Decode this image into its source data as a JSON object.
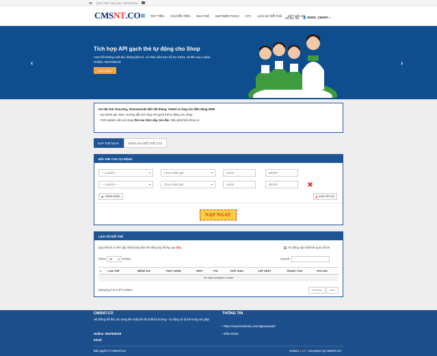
{
  "topbar": {
    "contact": "(0947 838 128) Zalo: 0947838128"
  },
  "brand": {
    "logo_part1": "CMS",
    "logo_part2": "NT",
    "logo_part3": ".CO"
  },
  "nav": {
    "items": [
      "RÚT TIỀN",
      "CHUYỂN TIỀN",
      "MUA THẺ",
      "NẠP ĐIỆN THOẠI",
      "CTV",
      "LỊCH SỬ ĐỔI THẺ",
      "KẾT NỐI API"
    ],
    "balance": "Số Dư: 0đ",
    "user": "DEMO_CMSNT"
  },
  "hero": {
    "title": "Tích hợp API gạch thẻ tự động cho Shop",
    "description": "Cam kết không nuốt thẻ, không bảo trì, có nhân viên trực hỗ trợ 24/24, rút tiền sau 1 phút. Hotline: 0947838128",
    "button": "XEM NGAY",
    "prev": "‹",
    "next": "›"
  },
  "notice": {
    "line1": "Ưu tiên thẻ Vina,Zing, Vietnammobi đến hết thẻng. Viettel và Zing cân điền đúng SERI",
    "line2": "- Sai mệnh giá -50%. Hướng dẫn tích hợp API gạch thẻ tự động cho Shop.",
    "line3_prefix": "- TSR nghiêm cấm sử dụng ",
    "line3_bold": "thẻ cào trộm cắp, lừa đảo",
    "line3_suffix": ". Nếu phát hiện khóa vv"
  },
  "tabs": {
    "active": "NẠP THẺ NGAY",
    "inactive": "BẢNG GIÁ ĐỔI THẺ CÀO"
  },
  "exchange": {
    "header": "ĐỔI THẺ CÀO TỰ ĐỘNG",
    "type_placeholder": "-- Loại thẻ --",
    "amount_placeholder": "Chọn mệnh giá",
    "serial_placeholder": "Serial",
    "code_placeholder": "Mã thẻ",
    "add_button": "THÊM NGÀY",
    "clear_button": "XOÁ TẤT CẢ",
    "submit": "NẠP NGAY"
  },
  "history": {
    "header": "LỊCH SỬ ĐỔI THẺ",
    "hint_prefix": "Quý khách có thể cập nhật trạng thái thẻ bằng tay thông qua ",
    "hint_link": "đây",
    "auto_update": "Tự động cập nhật kết quả mỗi 3s",
    "show_label": "Show",
    "entries_value": "10",
    "entries_label": "entries",
    "search_label": "Search:",
    "columns": [
      "#",
      "LOẠI THẺ",
      "MỆNH GIÁ",
      "THỰC NHẬN",
      "SERI",
      "PIN",
      "THỜI GIAN",
      "CẬP NHẬT",
      "TRẠNG THÁI",
      "GHI CHÚ"
    ],
    "empty": "No data available in table",
    "info": "Showing 0 to 0 of 0 entries",
    "prev": "Previous",
    "next": "Next"
  },
  "footer": {
    "brand": "CMSNT.CO",
    "about": "Hệ thống đổi thẻ cào sang tiền mặt phí tốt nhất thị trường - tự động xử lý thẻ trong vài giây!",
    "hotline": "Hotline: 0947838128",
    "email": "Email:",
    "info_title": "THÔNG TIN",
    "link1": "https://www.facebook.com/ntgtanetwork/",
    "link2": "Điều khoản",
    "copyright": "Bản quyền © CMSNT.CO",
    "version_prefix": "Version ",
    "version": "1.0.5",
    "version_suffix": " - Developer by CMSNT.CO"
  }
}
